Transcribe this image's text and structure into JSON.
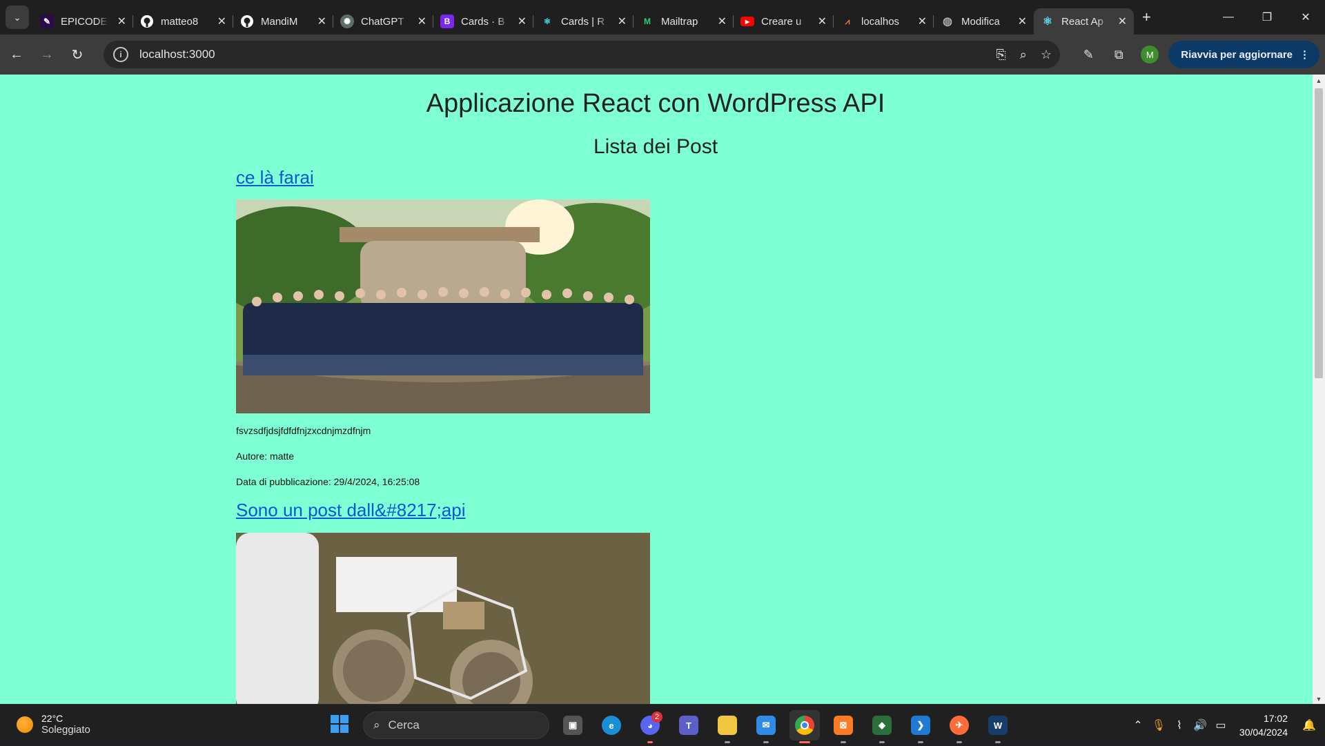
{
  "browser": {
    "tabs": [
      {
        "title": "EPICODE",
        "icon": "epicode-icon",
        "color": "#2b0a4a"
      },
      {
        "title": "matteo8",
        "icon": "github-icon",
        "color": "#1f1f1f"
      },
      {
        "title": "MandiM",
        "icon": "github-icon",
        "color": "#1f1f1f"
      },
      {
        "title": "ChatGPT",
        "icon": "chatgpt-icon",
        "color": "#5a6f66"
      },
      {
        "title": "Cards · B",
        "icon": "bootstrap-icon",
        "color": "#7a27f5"
      },
      {
        "title": "Cards | R",
        "icon": "react-bootstrap-icon",
        "color": "#1f1f1f"
      },
      {
        "title": "Mailtrap",
        "icon": "mailtrap-icon",
        "color": "#1f1f1f"
      },
      {
        "title": "Creare u",
        "icon": "youtube-icon",
        "color": "#ff0000"
      },
      {
        "title": "localhos",
        "icon": "xampp-icon",
        "color": "#1f1f1f"
      },
      {
        "title": "Modifica",
        "icon": "globe-icon",
        "color": "#1f1f1f"
      },
      {
        "title": "React Ap",
        "icon": "react-icon",
        "color": "#1f1f1f",
        "active": true
      }
    ],
    "url": "localhost:3000",
    "profile_initial": "M",
    "update_label": "Riavvia per aggiornare"
  },
  "page": {
    "title": "Applicazione React con WordPress API",
    "subtitle": "Lista dei Post",
    "posts": [
      {
        "title": "ce là farai",
        "excerpt": "fsvzsdfjdsjfdfdfnjzxcdnjmzdfnjm",
        "author": "Autore: matte",
        "date": "Data di pubblicazione: 29/4/2024, 16:25:08"
      },
      {
        "title": "Sono un post dall&#8217;api"
      }
    ]
  },
  "taskbar": {
    "weather_temp": "22°C",
    "weather_condition": "Soleggiato",
    "search_placeholder": "Cerca",
    "discord_badge": "2",
    "time": "17:02",
    "date": "30/04/2024"
  }
}
